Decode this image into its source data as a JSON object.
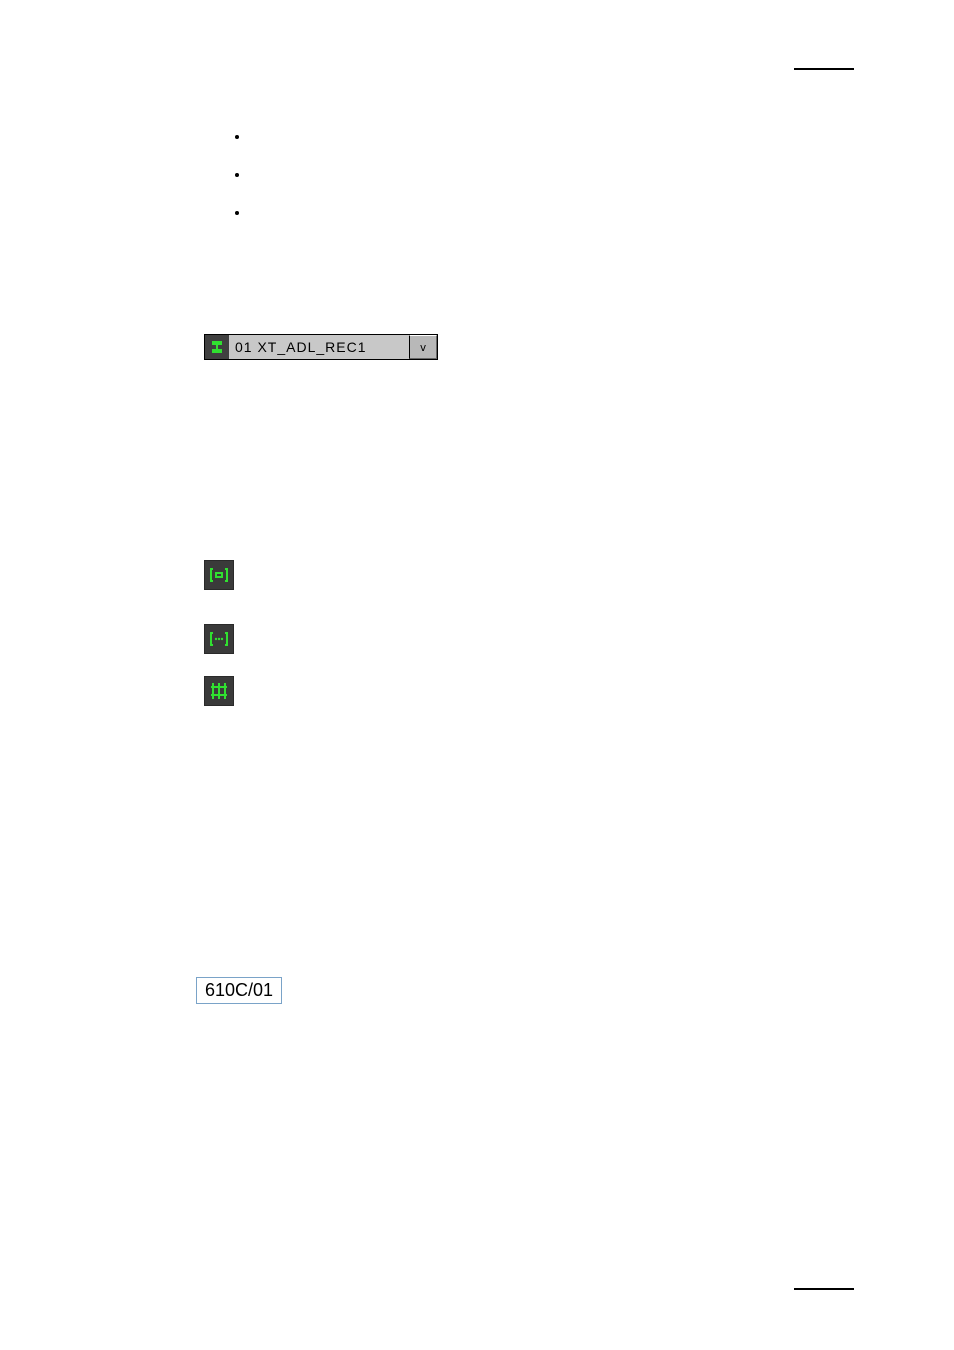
{
  "bullets": {
    "items": [
      "",
      "",
      ""
    ]
  },
  "dropdown": {
    "selected_label": "01 XT_ADL_REC1",
    "arrow_glyph": "v"
  },
  "code_box": {
    "value": "610C/01"
  },
  "icons": {
    "status": "status-ok-icon",
    "mode_a": "bracket-h-icon",
    "mode_b": "bracket-dots-icon",
    "mode_c": "grid-icon"
  }
}
